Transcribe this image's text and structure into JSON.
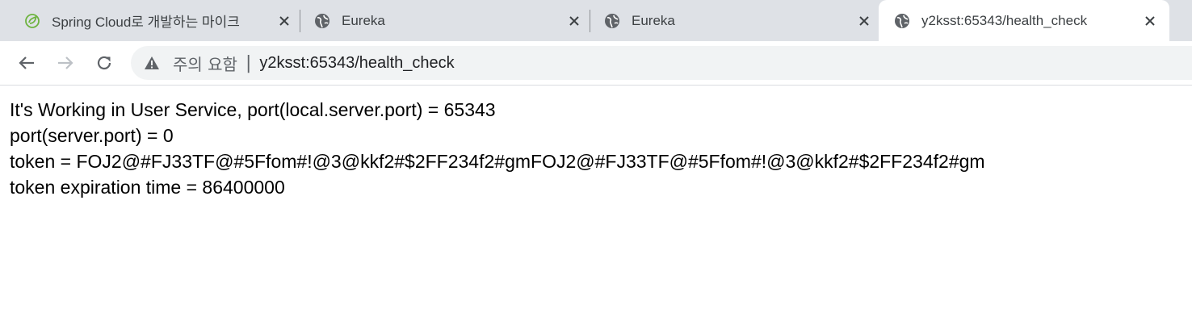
{
  "tabs": [
    {
      "title": "Spring Cloud로 개발하는 마이크",
      "icon": "spring-icon",
      "active": false
    },
    {
      "title": "Eureka",
      "icon": "globe-icon",
      "active": false
    },
    {
      "title": "Eureka",
      "icon": "globe-icon",
      "active": false
    },
    {
      "title": "y2ksst:65343/health_check",
      "icon": "globe-icon",
      "active": true
    }
  ],
  "address_bar": {
    "security_label": "주의 요함",
    "separator": "|",
    "url": "y2ksst:65343/health_check"
  },
  "page": {
    "lines": [
      "It's Working in User Service, port(local.server.port) = 65343",
      "port(server.port) = 0",
      "token = FOJ2@#FJ33TF@#5Ffom#!@3@kkf2#$2FF234f2#gmFOJ2@#FJ33TF@#5Ffom#!@3@kkf2#$2FF234f2#gm",
      "token expiration time = 86400000"
    ]
  },
  "colors": {
    "tabbar_bg": "#dee1e6",
    "spring_green": "#6db33f",
    "omnibox_bg": "#f1f3f4"
  }
}
